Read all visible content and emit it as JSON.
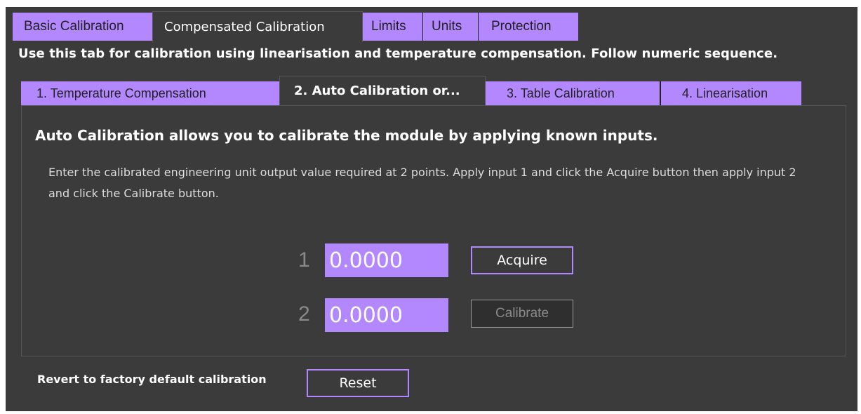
{
  "top_tabs": [
    {
      "label": "Basic Calibration",
      "active": false
    },
    {
      "label": "Compensated Calibration",
      "active": true
    },
    {
      "label": "Limits",
      "active": false
    },
    {
      "label": "Units",
      "active": false
    },
    {
      "label": "Protection",
      "active": false
    }
  ],
  "intro_text": "Use this tab for calibration using linearisation and temperature compensation. Follow numeric sequence.",
  "inner_tabs": [
    {
      "label": "1. Temperature Compensation",
      "active": false
    },
    {
      "label": "2. Auto Calibration or...",
      "active": true
    },
    {
      "label": "3. Table Calibration",
      "active": false
    },
    {
      "label": "4. Linearisation",
      "active": false
    }
  ],
  "panel": {
    "heading": "Auto Calibration allows you to calibrate the module by applying known inputs.",
    "description": "Enter the calibrated engineering unit output value required at 2 points. Apply input 1 and click the Acquire button then apply input 2 and click the Calibrate button.",
    "point1": {
      "number": "1",
      "value": "0.0000",
      "button": "Acquire"
    },
    "point2": {
      "number": "2",
      "value": "0.0000",
      "button": "Calibrate"
    }
  },
  "footer": {
    "label": "Revert to factory default calibration",
    "reset_button": "Reset"
  },
  "colors": {
    "accent": "#b388ff",
    "background": "#3b3b3b"
  }
}
